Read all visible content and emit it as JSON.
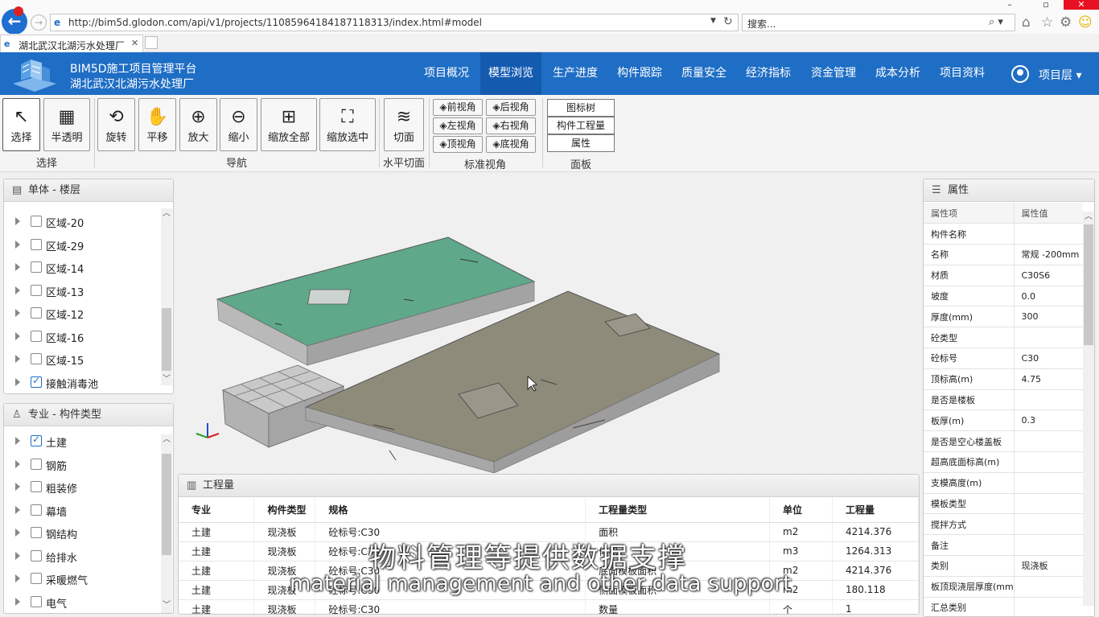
{
  "browser": {
    "url": "http://bim5d.glodon.com/api/v1/projects/110859641841871183​13/index.html#model",
    "search_placeholder": "搜索...",
    "tab_title": "湖北武汉北湖污水处理厂"
  },
  "header": {
    "title": "BIM5D施工项目管理平台",
    "subtitle": "湖北武汉北湖污水处理厂",
    "nav": [
      "项目概况",
      "模型浏览",
      "生产进度",
      "构件跟踪",
      "质量安全",
      "经济指标",
      "资金管理",
      "成本分析",
      "项目资料"
    ],
    "active_nav": "模型浏览",
    "user": "项目层"
  },
  "toolbar": {
    "select": "选择",
    "translucent": "半透明",
    "group_select": "选择",
    "rotate": "旋转",
    "pan": "平移",
    "zoom_in": "放大",
    "zoom_out": "缩小",
    "zoom_all": "缩放全部",
    "zoom_selected": "缩放选中",
    "group_nav": "导航",
    "section": "切面",
    "group_section": "水平切面",
    "views": [
      "前视角",
      "后视角",
      "左视角",
      "右视角",
      "顶视角",
      "底视角"
    ],
    "group_views": "标准视角",
    "panels": [
      "图标树",
      "构件工程量",
      "属性"
    ],
    "group_panels": "面板"
  },
  "floor_panel": {
    "title": "单体 - 楼层",
    "items": [
      {
        "label": "区域-20",
        "checked": false
      },
      {
        "label": "区域-29",
        "checked": false
      },
      {
        "label": "区域-14",
        "checked": false
      },
      {
        "label": "区域-13",
        "checked": false
      },
      {
        "label": "区域-12",
        "checked": false
      },
      {
        "label": "区域-16",
        "checked": false
      },
      {
        "label": "区域-15",
        "checked": false
      },
      {
        "label": "接触消毒池",
        "checked": true
      }
    ]
  },
  "type_panel": {
    "title": "专业 - 构件类型",
    "items": [
      {
        "label": "土建",
        "checked": true
      },
      {
        "label": "钢筋",
        "checked": false
      },
      {
        "label": "粗装修",
        "checked": false
      },
      {
        "label": "幕墙",
        "checked": false
      },
      {
        "label": "钢结构",
        "checked": false
      },
      {
        "label": "给排水",
        "checked": false
      },
      {
        "label": "采暖燃气",
        "checked": false
      },
      {
        "label": "电气",
        "checked": false
      }
    ]
  },
  "quantity_panel": {
    "title": "工程量",
    "columns": [
      "专业",
      "构件类型",
      "规格",
      "工程量类型",
      "单位",
      "工程量"
    ],
    "rows": [
      [
        "土建",
        "现浇板",
        "砼标号:C30",
        "面积",
        "m2",
        "4214.376"
      ],
      [
        "土建",
        "现浇板",
        "砼标号:C30",
        "体积",
        "m3",
        "1264.313"
      ],
      [
        "土建",
        "现浇板",
        "砼标号:C30",
        "底面模板面积",
        "m2",
        "4214.376"
      ],
      [
        "土建",
        "现浇板",
        "砼标号:C30",
        "侧面模板面积",
        "m2",
        "180.118"
      ],
      [
        "土建",
        "现浇板",
        "砼标号:C30",
        "数量",
        "个",
        "1"
      ]
    ]
  },
  "property_panel": {
    "title": "属性",
    "header": [
      "属性项",
      "属性值"
    ],
    "rows": [
      [
        "构件名称",
        ""
      ],
      [
        "名称",
        "常规 -200mm"
      ],
      [
        "材质",
        "C30S6"
      ],
      [
        "坡度",
        "0.0"
      ],
      [
        "厚度(mm)",
        "300"
      ],
      [
        "砼类型",
        ""
      ],
      [
        "砼标号",
        "C30"
      ],
      [
        "顶标高(m)",
        "4.75"
      ],
      [
        "是否是楼板",
        ""
      ],
      [
        "板厚(m)",
        "0.3"
      ],
      [
        "是否是空心楼盖板",
        ""
      ],
      [
        "超高底面标高(m)",
        ""
      ],
      [
        "支模高度(m)",
        ""
      ],
      [
        "模板类型",
        ""
      ],
      [
        "搅拌方式",
        ""
      ],
      [
        "备注",
        ""
      ],
      [
        "类别",
        "现浇板"
      ],
      [
        "板顶现浇层厚度(mm)",
        ""
      ],
      [
        "汇总类别",
        ""
      ]
    ]
  },
  "subtitles": {
    "cn": "物料管理等提供数据支撑",
    "en": "material management and other data support"
  },
  "colors": {
    "header_bg": "#1f6ec5",
    "slab_green": "#5fa88a",
    "slab_gray": "#8e8b7a"
  }
}
